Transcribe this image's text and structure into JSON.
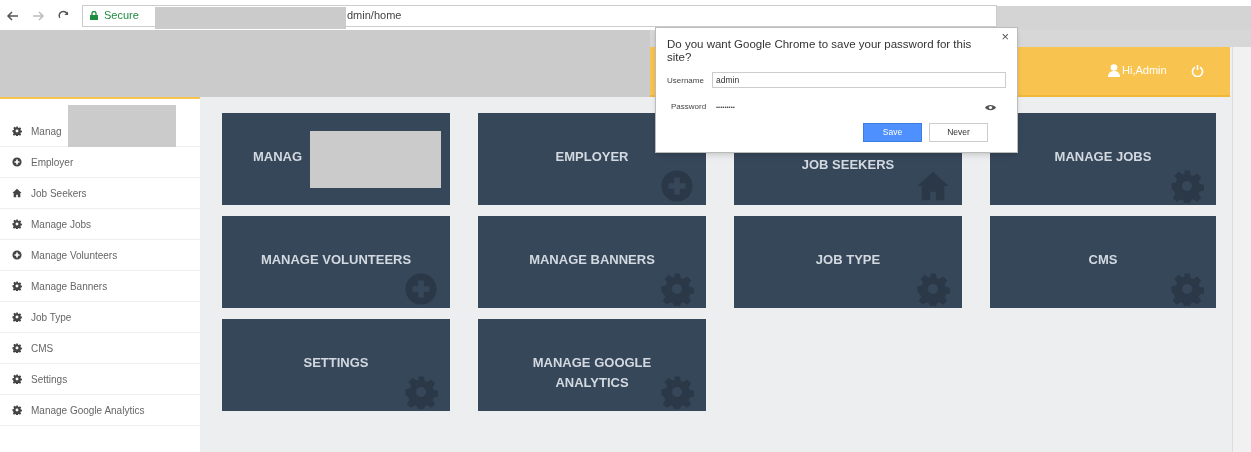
{
  "browser": {
    "secure_label": "Secure",
    "url": "dmin/home"
  },
  "header": {
    "greeting": "Hi,Admin"
  },
  "sidebar": {
    "items": [
      {
        "label": "Manag"
      },
      {
        "label": "Employer"
      },
      {
        "label": "Job Seekers"
      },
      {
        "label": "Manage Jobs"
      },
      {
        "label": "Manage Volunteers"
      },
      {
        "label": "Manage Banners"
      },
      {
        "label": "Job Type"
      },
      {
        "label": "CMS"
      },
      {
        "label": "Settings"
      },
      {
        "label": "Manage Google Analytics"
      }
    ]
  },
  "tiles": [
    {
      "label": "MANAG"
    },
    {
      "label": "EMPLOYER"
    },
    {
      "label": "JOB SEEKERS"
    },
    {
      "label": "MANAGE JOBS"
    },
    {
      "label": "MANAGE VOLUNTEERS"
    },
    {
      "label": "MANAGE BANNERS"
    },
    {
      "label": "JOB TYPE"
    },
    {
      "label": "CMS"
    },
    {
      "label": "SETTINGS"
    },
    {
      "label": "MANAGE GOOGLE\nANALYTICS"
    }
  ],
  "password_dialog": {
    "title": "Do you want Google Chrome to save your password for this site?",
    "username_label": "Username",
    "username": "admin",
    "password_label": "Password",
    "password": "•••••••••",
    "close": "×",
    "buttons": [
      "Save",
      "Never"
    ]
  }
}
